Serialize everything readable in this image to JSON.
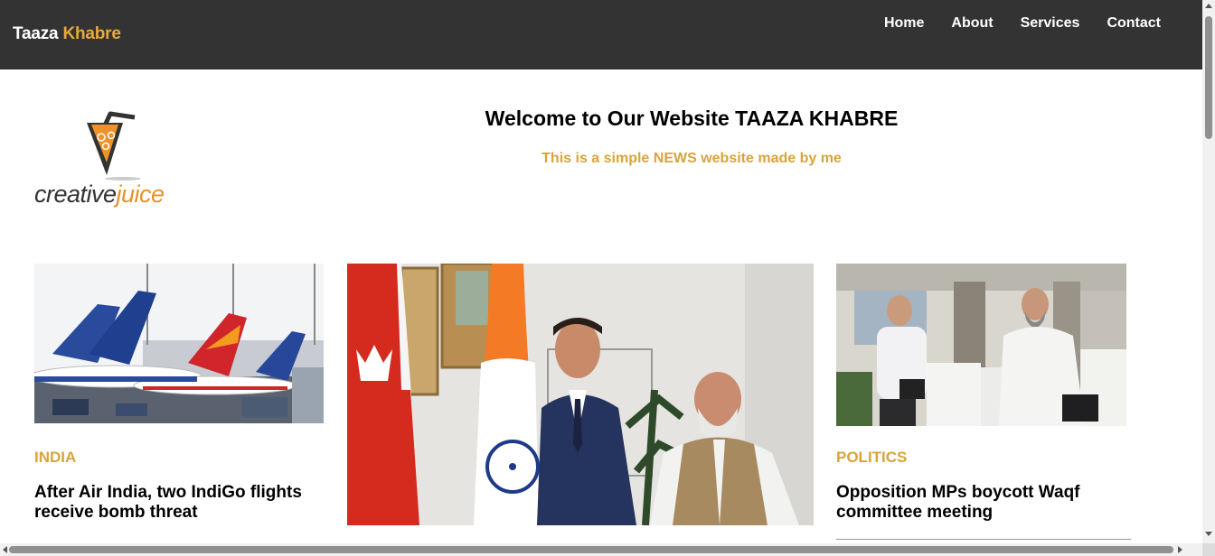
{
  "site": {
    "brand_part1": "Taaza ",
    "brand_part2": "Khabre",
    "brand_accent_color": "#e8a93a",
    "navbar_color": "#333333"
  },
  "nav": {
    "items": [
      {
        "label": "Home"
      },
      {
        "label": "About"
      },
      {
        "label": "Services"
      },
      {
        "label": "Contact"
      }
    ]
  },
  "logo": {
    "text_part1": "creative",
    "text_part2": "juice",
    "icon": "juice-glass-pencil-logo"
  },
  "hero": {
    "title": "Welcome to Our Website TAAZA KHABRE",
    "subtitle": "This is a simple NEWS website made by me",
    "subtitle_color": "#d9a43a"
  },
  "cards": [
    {
      "image": "airplanes-airport-photo",
      "category": "INDIA",
      "headline": "After Air India, two IndiGo flights receive bomb threat"
    },
    {
      "image": "two-leaders-handshake-flags-photo"
    },
    {
      "image": "politicians-walking-photo",
      "category": "POLITICS",
      "headline": "Opposition MPs boycott Waqf committee meeting"
    }
  ]
}
